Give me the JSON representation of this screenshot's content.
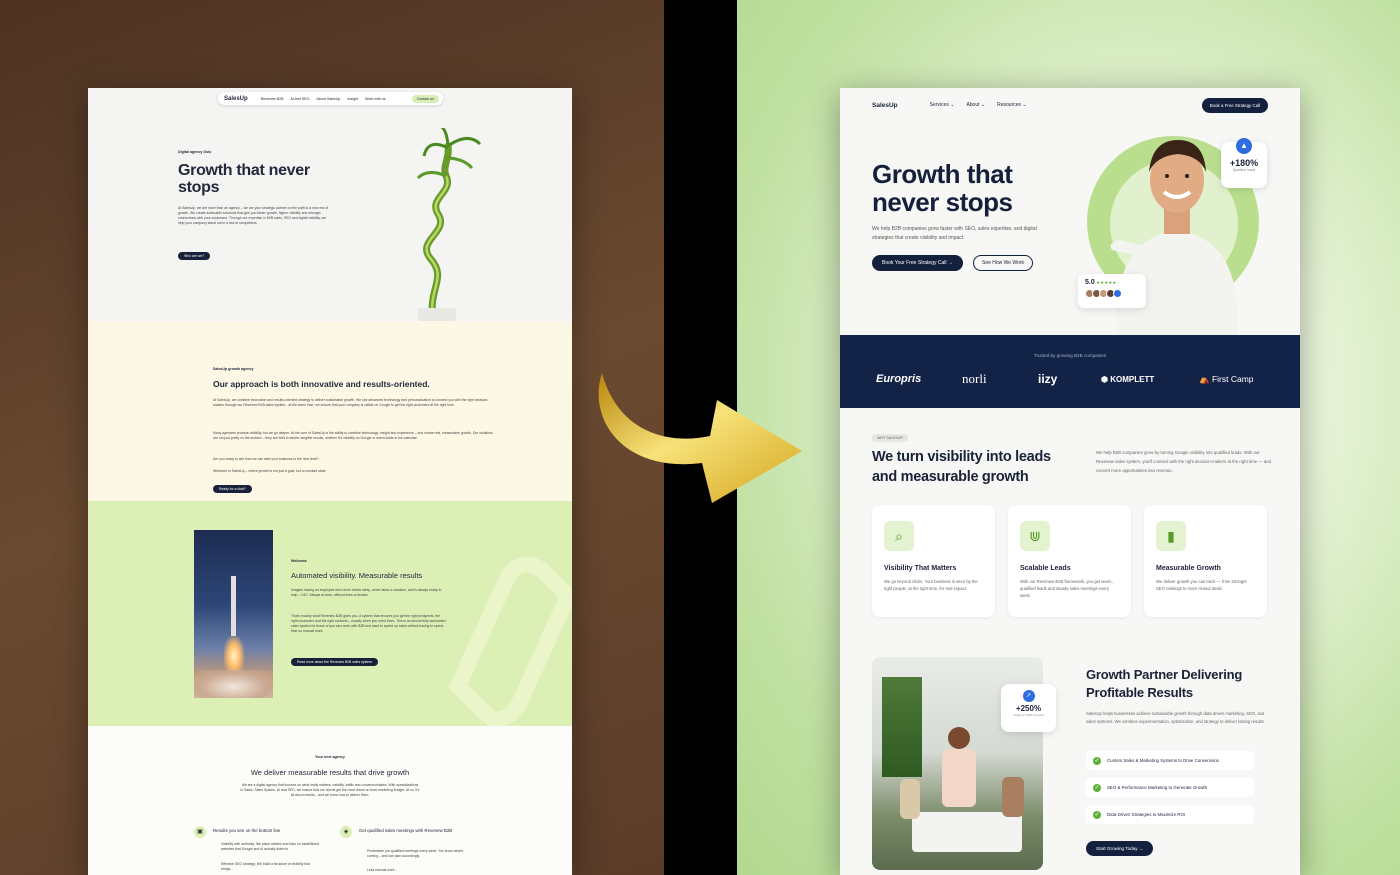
{
  "left_page": {
    "nav": {
      "logo": "SalesUp",
      "items": [
        "Revenew B2B",
        "AI-first SEO",
        "About SalesUp",
        "Insight",
        "Work with us"
      ],
      "cta": "Contact us"
    },
    "hero": {
      "eyebrow": "Digital agency Oslo",
      "title": "Growth that never stops",
      "body": "At SalesUp, we are more than an agency – we are your strategic partner on the path to a new era of growth. We create actionable solutions that give you faster growth, higher visibility and stronger connections with your customers. Through our expertise in B2B sales, SEO and digital visibility, we help your company stand out in a sea of competitors.",
      "button": "Who are we?"
    },
    "approach": {
      "eyebrow": "SalesUp growth agency",
      "title": "Our approach is both innovative and results-oriented.",
      "p1": "At SalesUp, we combine innovation and results-oriented strategy to deliver sustainable growth. We use advanced technology and personalization to connect you with the right decision-makers through our Revenew B2B sales system - at the same time, we ensure that your company is visible on Google to get the right customers at the right time.",
      "p2": "Many agencies promise visibility, but we go deeper. At the core of SalesUp is the ability to combine technology, insight and experience – and create real, measurable growth. Our solutions are not just pretty on the surface – they are built to deliver tangible results, whether it's visibility on Google or warm leads in the calendar.",
      "p3": "Are you ready to see how we can take your business to the next level?",
      "p4": "Welcome to SalesUp – where growth is not just a goal, but a constant state.",
      "button": "Ready for a chat?"
    },
    "welcome": {
      "eyebrow": "Welcome",
      "title": "Automated visibility. Measurable results",
      "p1": "Imagine having an employee who never needs sleep, never takes a vacation, and is always ready to help – 24/7. Always at work, without lines or breaks.",
      "p2": "That's exactly what Revenew B2B gives you. A system that ensures you get the right prospects, the right customers and the right contacts – exactly when you need them. This is an almost fully automated sales system for those of you who work with B2B and want to speed up sales without having to spend time on manual work.",
      "button": "Read more about the Revenew B2B sales system"
    },
    "results": {
      "eyebrow": "Your next agency",
      "title": "We deliver measurable results that drive growth",
      "body": "We are a digital agency that focuses on what really matters: visibility, traffic and conversion/sales. With specializations in Sales, Sales System, AI and SEO, we ensure that our clients get the most return on their marketing budget. At us, it's all about results – and we know how to deliver them.",
      "col1_title": "Results you see on the bottom line",
      "col1_items": [
        "Visibility with authority: We place articles and links on established websites that Google and AI actually listen to",
        "Effective SEO strategy: We build a structure of visibility that brings..."
      ],
      "col2_title": "Get qualified sales meetings with Revenew B2B",
      "col2_items": [
        "Predictable pre-qualified meetings every week. You know what's coming – and can plan accordingly.",
        "Less manual work..."
      ]
    }
  },
  "right_page": {
    "nav": {
      "logo": "SalesUp",
      "menu": [
        "Services",
        "About",
        "Resources"
      ],
      "cta": "Book a Free Strategy Call"
    },
    "hero": {
      "title": "Growth that never stops",
      "body": "We help B2B companies grow faster with SEO, sales expertise, and digital strategies that create visibility and impact.",
      "primary_button": "Book Your Free Strategy Call",
      "secondary_button": "See How We Work",
      "stat_value": "+180%",
      "stat_label": "Qualified leads",
      "rating": "5.0",
      "stars": "★★★★★"
    },
    "trusted": {
      "label": "Trusted by growing B2B companies",
      "logos": [
        "Europris",
        "norli",
        "iizy",
        "KOMPLETT",
        "First Camp"
      ]
    },
    "why": {
      "eyebrow": "WHY SALESUP",
      "title": "We turn visibility into leads and measurable growth",
      "body": "We help B2B companies grow by turning Google visibility into qualified leads. With our Revenew sales system, you'll connect with the right decision-makers at the right time — and convert more opportunities into revenue."
    },
    "features": [
      {
        "title": "Visibility That Matters",
        "desc": "We go beyond clicks. Your business is seen by the right people, at the right time, for real impact."
      },
      {
        "title": "Scalable Leads",
        "desc": "With our Revenew B2B framework, you get warm, qualified leads and steady sales meetings every week."
      },
      {
        "title": "Measurable Growth",
        "desc": "We deliver growth you can track — from stronger SEO rankings to more closed deals."
      }
    ],
    "partner": {
      "title": "Growth Partner Delivering Profitable Results",
      "body": "SalesUp helps businesses achieve sustainable growth through data-driven marketing, SEO, and sales systems. We combine experimentation, optimization, and strategy to deliver lasting results.",
      "stat_value": "+250%",
      "stat_label": "Organic Traffic Growth",
      "checks": [
        "Custom Sales & Marketing Systems to Drive Conversions",
        "SEO & Performance Marketing to Generate Growth",
        "Data-Driven Strategies to Maximize ROI"
      ],
      "button": "Start Growing Today"
    }
  },
  "colors": {
    "navy": "#13213f",
    "lime": "#bfe0a0",
    "accent_green": "#5cb035",
    "arrow_gold": "#d9b224",
    "brown_bg": "#5a3c28"
  }
}
